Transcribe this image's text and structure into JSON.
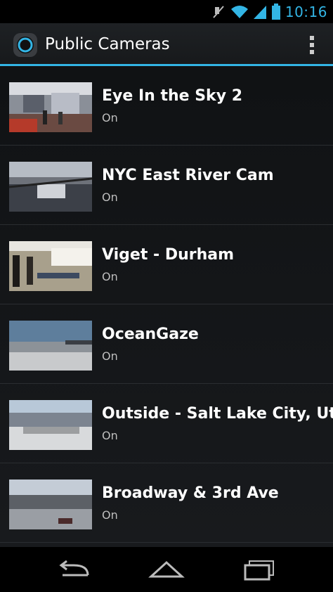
{
  "status": {
    "time": "10:16"
  },
  "app": {
    "title": "Public Cameras"
  },
  "cameras": [
    {
      "name": "Eye In the Sky 2",
      "status": "On"
    },
    {
      "name": "NYC East River Cam",
      "status": "On"
    },
    {
      "name": "Viget - Durham",
      "status": "On"
    },
    {
      "name": "OceanGaze",
      "status": "On"
    },
    {
      "name": "Outside - Salt Lake City, Utah",
      "status": "On"
    },
    {
      "name": "Broadway & 3rd Ave",
      "status": "On"
    }
  ],
  "colors": {
    "accent": "#33b5e5",
    "background": "#000000"
  },
  "icons": [
    "mute-icon",
    "wifi-icon",
    "signal-icon",
    "battery-icon",
    "overflow-menu-icon",
    "back-icon",
    "home-icon",
    "recent-apps-icon"
  ]
}
